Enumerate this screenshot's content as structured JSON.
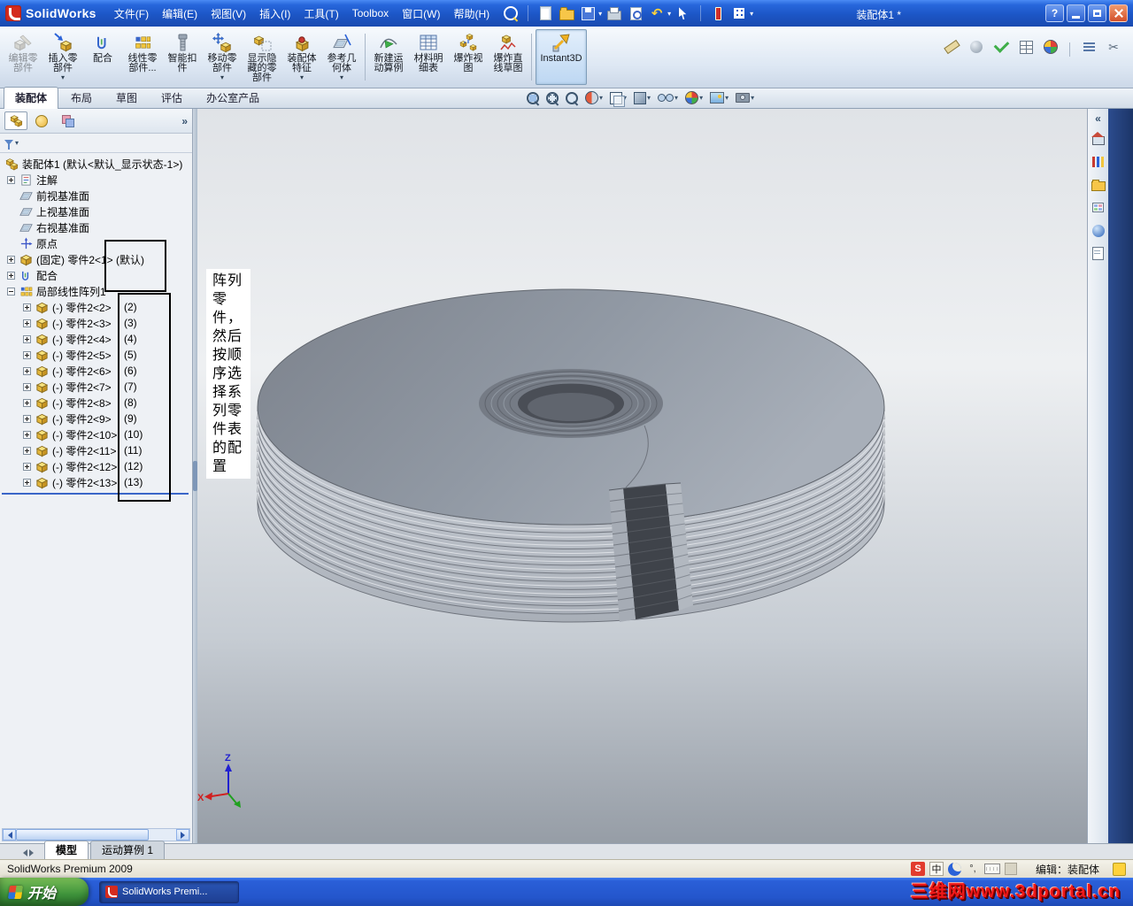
{
  "title_bar": {
    "logo_text": "SolidWorks",
    "menus": [
      "文件(F)",
      "编辑(E)",
      "视图(V)",
      "插入(I)",
      "工具(T)",
      "Toolbox",
      "窗口(W)",
      "帮助(H)"
    ],
    "document_title": "装配体1 *",
    "help_label": "?"
  },
  "command_manager": {
    "buttons": [
      {
        "label": "编辑零部件",
        "state": "disabled"
      },
      {
        "label": "插入零部件",
        "dropdown": true
      },
      {
        "label": "配合"
      },
      {
        "label": "线性零部件..."
      },
      {
        "label": "智能扣件"
      },
      {
        "label": "移动零部件",
        "dropdown": true
      },
      {
        "label": "显示隐藏的零部件"
      },
      {
        "label": "装配体特征",
        "dropdown": true
      },
      {
        "label": "参考几何体",
        "dropdown": true
      },
      {
        "label": "新建运动算例"
      },
      {
        "label": "材料明细表"
      },
      {
        "label": "爆炸视图"
      },
      {
        "label": "爆炸直线草图"
      },
      {
        "label": "Instant3D",
        "state": "active"
      }
    ]
  },
  "ribbon_tabs": {
    "items": [
      "装配体",
      "布局",
      "草图",
      "评估",
      "办公室产品"
    ],
    "active": "装配体"
  },
  "feature_tree": {
    "items": [
      {
        "label": "装配体1 (默认<默认_显示状态-1>)"
      },
      {
        "label": "注解"
      },
      {
        "label": "前视基准面"
      },
      {
        "label": "上视基准面"
      },
      {
        "label": "右视基准面"
      },
      {
        "label": "原点"
      },
      {
        "label": "(固定) 零件2<1> (默认)"
      },
      {
        "label": "配合"
      },
      {
        "label": "局部线性阵列1"
      },
      {
        "label": "(-) 零件2<2>",
        "count": "(2)"
      },
      {
        "label": "(-) 零件2<3>",
        "count": "(3)"
      },
      {
        "label": "(-) 零件2<4>",
        "count": "(4)"
      },
      {
        "label": "(-) 零件2<5>",
        "count": "(5)"
      },
      {
        "label": "(-) 零件2<6>",
        "count": "(6)"
      },
      {
        "label": "(-) 零件2<7>",
        "count": "(7)"
      },
      {
        "label": "(-) 零件2<8>",
        "count": "(8)"
      },
      {
        "label": "(-) 零件2<9>",
        "count": "(9)"
      },
      {
        "label": "(-) 零件2<10>",
        "count": "(10)"
      },
      {
        "label": "(-) 零件2<11>",
        "count": "(11)"
      },
      {
        "label": "(-) 零件2<12>",
        "count": "(12)"
      },
      {
        "label": "(-) 零件2<13>",
        "count": "(13)"
      }
    ]
  },
  "annotation_note": {
    "text": "阵列零件，然后按顺序选择系列零件表的配置"
  },
  "triad": {
    "x": "X",
    "z": "Z"
  },
  "bottom_tabs": {
    "items": [
      "模型",
      "运动算例 1"
    ],
    "active": "模型"
  },
  "status_bar": {
    "left": "SolidWorks Premium 2009",
    "ime_s": "S",
    "ime_cn": "中",
    "ime_punct": "°,",
    "edit_label": "编辑：装配体"
  },
  "taskbar": {
    "start_label": "开始",
    "task_label": "SolidWorks Premi...",
    "watermark": "三维网www.3dportal.cn"
  },
  "colors": {
    "titlebar_blue": "#1c56c6",
    "taskbar_blue": "#2456cc",
    "start_green": "#3e933b",
    "active_button_blue": "#bdd7f2",
    "watermark_red": "#f01818",
    "model_gray": "#9199a4"
  }
}
